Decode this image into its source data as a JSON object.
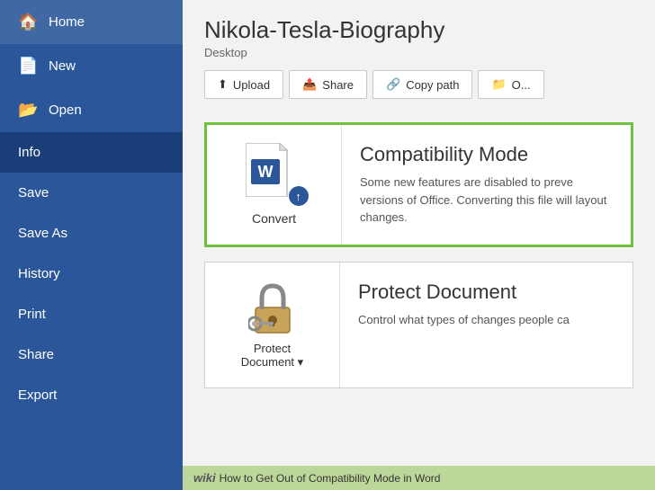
{
  "sidebar": {
    "items": [
      {
        "id": "home",
        "label": "Home",
        "icon": "🏠"
      },
      {
        "id": "new",
        "label": "New",
        "icon": "📄"
      },
      {
        "id": "open",
        "label": "Open",
        "icon": "📂"
      },
      {
        "id": "info",
        "label": "Info",
        "icon": "",
        "active": true
      },
      {
        "id": "save",
        "label": "Save",
        "icon": ""
      },
      {
        "id": "saveas",
        "label": "Save As",
        "icon": ""
      },
      {
        "id": "history",
        "label": "History",
        "icon": ""
      },
      {
        "id": "print",
        "label": "Print",
        "icon": ""
      },
      {
        "id": "share",
        "label": "Share",
        "icon": ""
      },
      {
        "id": "export",
        "label": "Export",
        "icon": ""
      }
    ]
  },
  "document": {
    "title": "Nikola-Tesla-Biography",
    "location": "Desktop"
  },
  "action_buttons": [
    {
      "id": "upload",
      "label": "Upload",
      "icon": "⬆"
    },
    {
      "id": "share",
      "label": "Share",
      "icon": "📤"
    },
    {
      "id": "copy_path",
      "label": "Copy path",
      "icon": "🔗"
    },
    {
      "id": "open",
      "label": "O...",
      "icon": "📁"
    }
  ],
  "cards": [
    {
      "id": "convert",
      "icon_label": "Convert",
      "title": "Compatibility Mode",
      "description": "Some new features are disabled to preve versions of Office. Converting this file will layout changes.",
      "highlighted": true
    },
    {
      "id": "protect",
      "icon_label": "Protect\nDocument ▾",
      "title": "Protect Document",
      "description": "Control what types of changes people ca"
    }
  ],
  "footer": {
    "wiki_label": "wiki",
    "text": "How to Get Out of Compatibility Mode in Word"
  }
}
